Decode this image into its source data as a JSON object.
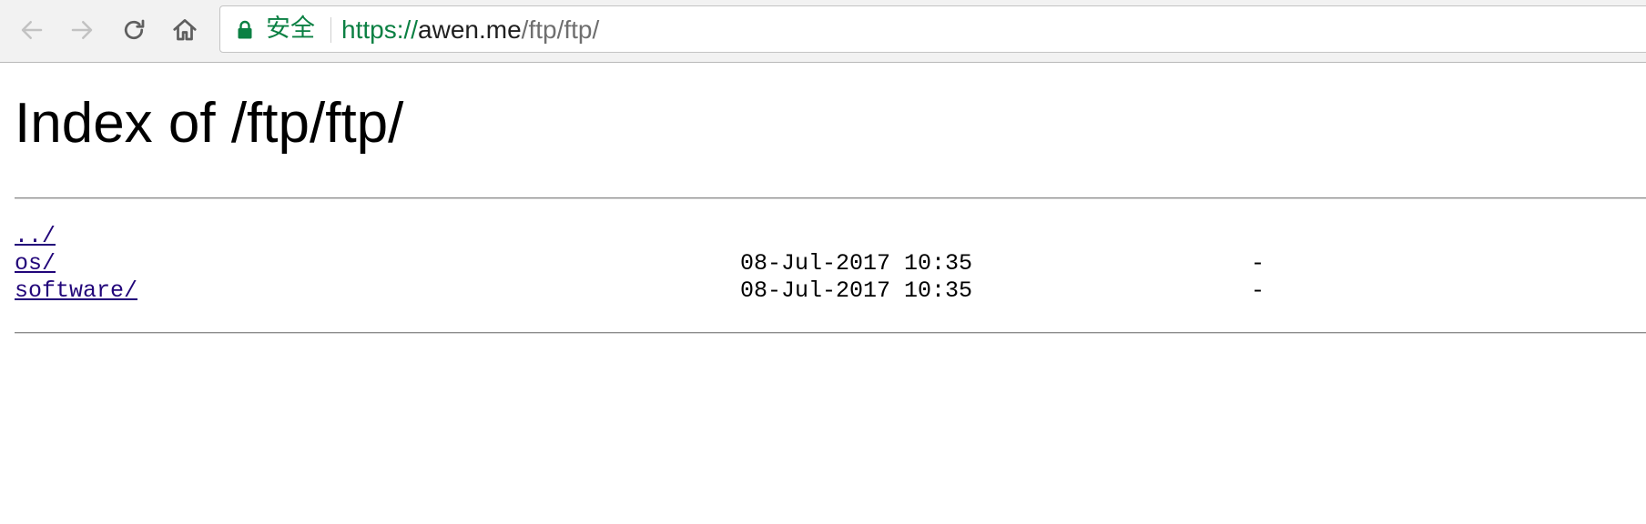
{
  "browser": {
    "back_icon": "arrow-left-icon",
    "forward_icon": "arrow-right-icon",
    "reload_icon": "reload-icon",
    "home_icon": "home-icon",
    "lock_icon": "lock-icon",
    "secure_label": "安全",
    "url": {
      "scheme": "https://",
      "host": "awen.me",
      "path": "/ftp/ftp/"
    },
    "colors": {
      "secure_green": "#0b8043",
      "link": "#22067a"
    }
  },
  "page": {
    "title": "Index of /ftp/ftp/",
    "entries": [
      {
        "name": "../",
        "date": "",
        "size": ""
      },
      {
        "name": "os/",
        "date": "08-Jul-2017 10:35",
        "size": "-"
      },
      {
        "name": "software/",
        "date": "08-Jul-2017 10:35",
        "size": "-"
      }
    ]
  }
}
